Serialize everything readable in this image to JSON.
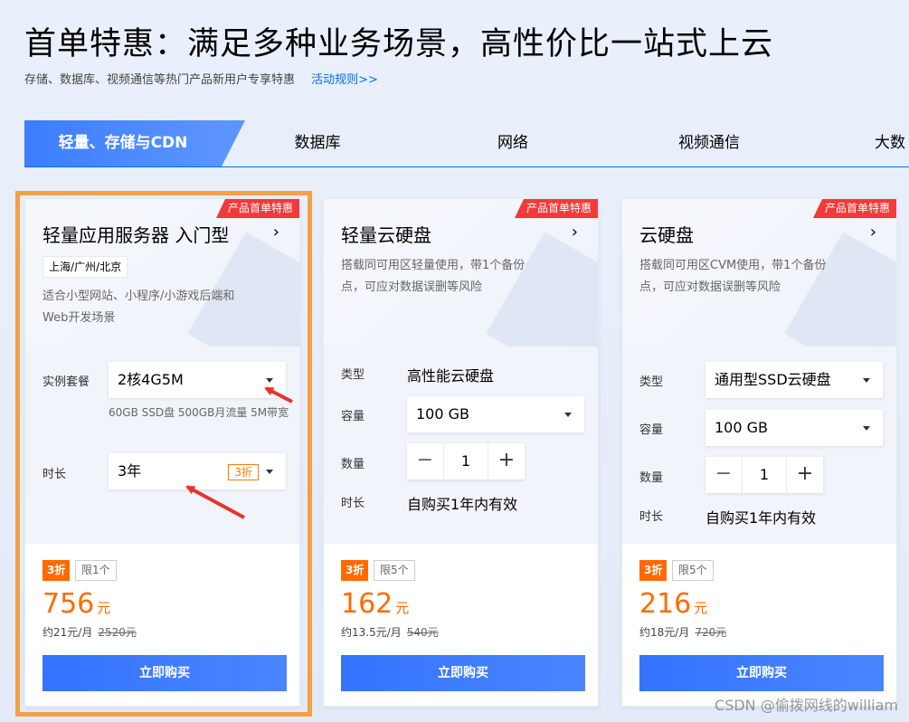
{
  "header": {
    "title": "首单特惠：满足多种业务场景，高性价比一站式上云",
    "subtitle": "存储、数据库、视频通信等热门产品新用户专享特惠",
    "rules_link": "活动规则>>"
  },
  "tabs": [
    {
      "label": "轻量、存储与CDN",
      "active": true
    },
    {
      "label": "数据库"
    },
    {
      "label": "网络"
    },
    {
      "label": "视频通信"
    },
    {
      "label": "大数"
    }
  ],
  "cards": [
    {
      "ribbon": "产品首单特惠",
      "title": "轻量应用服务器 入门型",
      "arrow": "›",
      "region": "上海/广州/北京",
      "desc_line1": "适合小型网站、小程序/小游戏后端和",
      "desc_line2": "Web开发场景",
      "spec_label": "实例套餐",
      "spec_value": "2核4G5M",
      "spec_note": "60GB SSD盘 500GB月流量 5M带宽",
      "duration_label": "时长",
      "duration_value": "3年",
      "duration_discount": "3折",
      "discount": "3折",
      "limit": "限1个",
      "price": "756",
      "price_unit": "元",
      "monthly": "约21元/月",
      "original": "2520元",
      "buy": "立即购买"
    },
    {
      "ribbon": "产品首单特惠",
      "title": "轻量云硬盘",
      "arrow": "›",
      "desc_line1": "搭载同可用区轻量使用，带1个备份",
      "desc_line2": "点，可应对数据误删等风险",
      "type_label": "类型",
      "type_value": "高性能云硬盘",
      "capacity_label": "容量",
      "capacity_value": "100 GB",
      "qty_label": "数量",
      "qty_value": "1",
      "minus": "−",
      "plus": "+",
      "duration_label": "时长",
      "duration_value": "自购买1年内有效",
      "discount": "3折",
      "limit": "限5个",
      "price": "162",
      "price_unit": "元",
      "monthly": "约13.5元/月",
      "original": "540元",
      "buy": "立即购买"
    },
    {
      "ribbon": "产品首单特惠",
      "title": "云硬盘",
      "arrow": "›",
      "desc_line1": "搭载同可用区CVM使用，带1个备份",
      "desc_line2": "点，可应对数据误删等风险",
      "type_label": "类型",
      "type_value": "通用型SSD云硬盘",
      "capacity_label": "容量",
      "capacity_value": "100 GB",
      "qty_label": "数量",
      "qty_value": "1",
      "minus": "−",
      "plus": "+",
      "duration_label": "时长",
      "duration_value": "自购买1年内有效",
      "discount": "3折",
      "limit": "限5个",
      "price": "216",
      "price_unit": "元",
      "monthly": "约18元/月",
      "original": "720元",
      "buy": "立即购买"
    }
  ],
  "watermark": "CSDN @偷拨网线的william",
  "colors": {
    "accent": "#3373ff",
    "price": "#ff6a00",
    "ribbon": "#f23a3a",
    "highlight": "#f5a047",
    "annotation_arrow": "#e8332a"
  }
}
